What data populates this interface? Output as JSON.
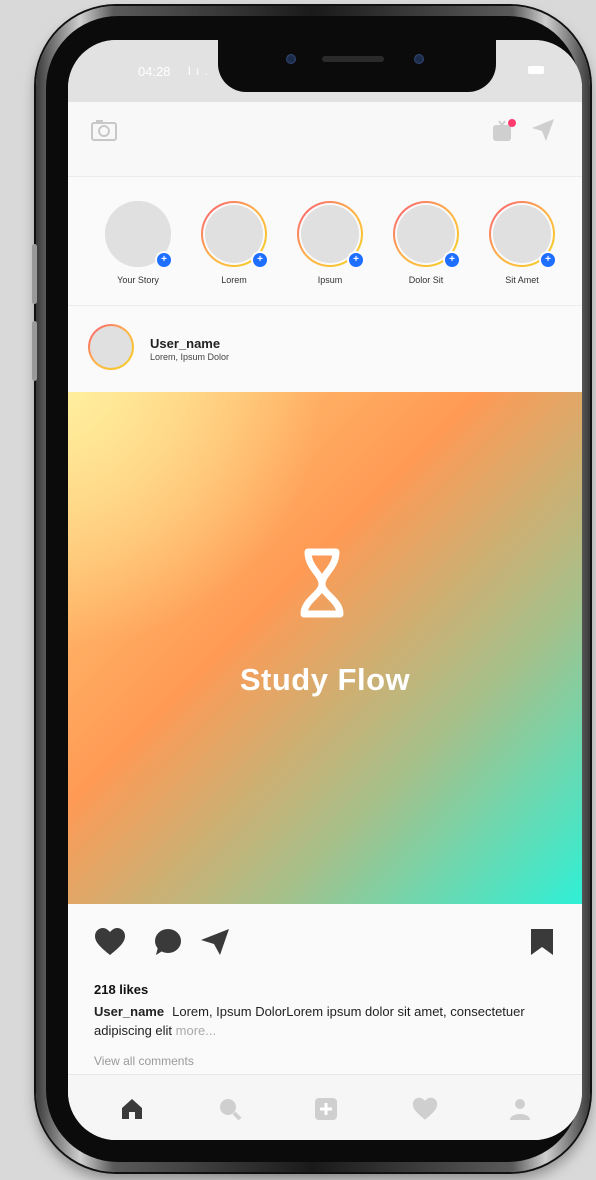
{
  "status_bar": {
    "time": "04:28",
    "signal": "l ı ."
  },
  "top_bar": {
    "camera_icon": "camera-icon",
    "tv_icon": "igtv-icon",
    "send_icon": "direct-message-icon",
    "notification_dot_color": "#ff3b6f"
  },
  "stories": [
    {
      "label": "Your Story",
      "own": true
    },
    {
      "label": "Lorem"
    },
    {
      "label": "Ipsum"
    },
    {
      "label": "Dolor Sit"
    },
    {
      "label": "Sit Amet"
    }
  ],
  "post": {
    "username": "User_name",
    "location": "Lorem, Ipsum Dolor",
    "image_title": "Study Flow",
    "likes": "218 likes",
    "caption_user": "User_name",
    "caption_text": "Lorem, Ipsum DolorLorem ipsum dolor sit amet, consectetuer adipiscing elit",
    "more": "more...",
    "view_comments": "View all comments"
  },
  "bottom_nav": [
    "home-icon",
    "search-icon",
    "add-post-icon",
    "activity-heart-icon",
    "profile-icon"
  ],
  "colors": {
    "accent_blue": "#1f6fff",
    "story_ring_start": "#f95a77",
    "story_ring_end": "#f5d020"
  }
}
